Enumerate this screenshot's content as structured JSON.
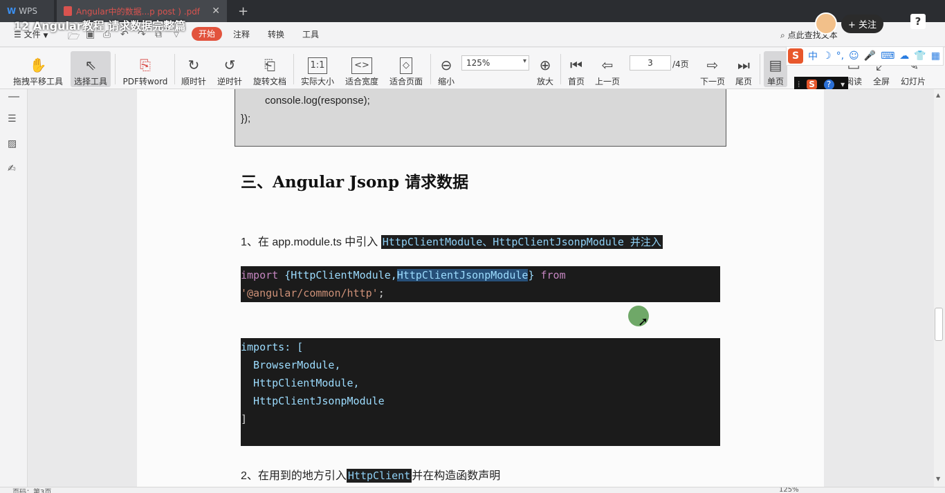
{
  "tabs": {
    "wps_label": "WPS",
    "doc_label": "Angular中的数据...p post ) .pdf",
    "close": "✕",
    "new_tab": "+"
  },
  "overlay": {
    "title": "12 Angular教程 请求数据完整篇",
    "follow_label": "关注",
    "follow_plus": "+",
    "help": "?"
  },
  "menu": {
    "file": "文件",
    "start": "开始",
    "annotate": "注释",
    "convert": "转换",
    "tools": "工具",
    "search": "点此查找文本"
  },
  "toolbar": {
    "hand_tool": "拖拽平移工具",
    "select_tool": "选择工具",
    "pdf_to_word": "PDF转word",
    "clockwise": "顺时针",
    "counterclockwise": "逆时针",
    "rotate_doc": "旋转文档",
    "actual_size": "实际大小",
    "fit_width": "适合宽度",
    "fit_page": "适合页面",
    "zoom_out": "缩小",
    "zoom_value": "125%",
    "zoom_in": "放大",
    "first_page": "首页",
    "prev_page": "上一页",
    "page_current": "3",
    "page_total": "/4页",
    "next_page": "下一页",
    "last_page": "尾页",
    "single_page": "单页",
    "read_mode": "阅读",
    "fullscreen": "全屏",
    "slideshow": "幻灯片"
  },
  "ime": {
    "logo": "S",
    "lang": "中"
  },
  "document": {
    "prev_code_line1": "console.log(response);",
    "prev_code_line2": "});",
    "heading": "三、Angular Jsonp 请求数据",
    "step1_prefix": "1、在 app.module.ts 中引入",
    "step1_highlight": "HttpClientModule、HttpClientJsonpModule 并注入",
    "code1_line1_kw": "import",
    "code1_line1_a": " {HttpClientModule,",
    "code1_line1_sel": "HttpClientJsonpModule",
    "code1_line1_b": "} ",
    "code1_line1_from": "from",
    "code1_line2_str": "'@angular/common/http'",
    "code1_line2_end": ";",
    "code2_line1": "imports: [",
    "code2_line2": "  BrowserModule,",
    "code2_line3": "  HttpClientModule,",
    "code2_line4": "  HttpClientJsonpModule",
    "code2_line5": "]",
    "step2_prefix": "2、在用到的地方引入",
    "step2_highlight": "HttpClient",
    "step2_suffix": "并在构造函数声明"
  },
  "status": {
    "page_info": "页码：第3页",
    "zoom": "125%"
  }
}
